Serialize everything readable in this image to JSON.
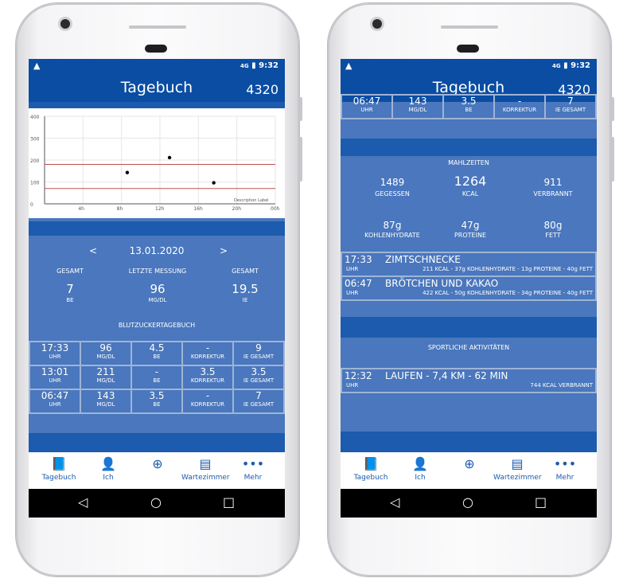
{
  "status": {
    "network": "4G",
    "time": "9:32"
  },
  "app": {
    "title": "Tagebuch",
    "points": "4320"
  },
  "chart_data": {
    "type": "scatter",
    "x_ticks": [
      "4h",
      "8h",
      "12h",
      "16h",
      "20h",
      "00h"
    ],
    "y_ticks": [
      "0",
      "100",
      "200",
      "300",
      "400"
    ],
    "ylim": [
      0,
      400
    ],
    "points": [
      {
        "x": 8.6,
        "y": 143
      },
      {
        "x": 13.0,
        "y": 211
      },
      {
        "x": 17.6,
        "y": 96
      }
    ],
    "limit_lines": [
      70,
      180
    ],
    "description_label": "Description Label",
    "line_color": "#c0504d"
  },
  "left": {
    "date": "13.01.2020",
    "prev_label": "<",
    "next_label": ">",
    "summary": [
      {
        "label": "GESAMT",
        "value": "7",
        "unit": "BE"
      },
      {
        "label": "LETZTE MESSUNG",
        "value": "96",
        "unit": "MG/DL"
      },
      {
        "label": "GESAMT",
        "value": "19.5",
        "unit": "IE"
      }
    ],
    "section_title": "BLUTZUCKERTAGEBUCH",
    "rows": [
      [
        {
          "v": "17:33",
          "u": "UHR"
        },
        {
          "v": "96",
          "u": "MG/DL"
        },
        {
          "v": "4.5",
          "u": "BE"
        },
        {
          "v": "-",
          "u": "KORREKTUR"
        },
        {
          "v": "9",
          "u": "IE GESAMT"
        }
      ],
      [
        {
          "v": "13:01",
          "u": "UHR"
        },
        {
          "v": "211",
          "u": "MG/DL"
        },
        {
          "v": "-",
          "u": "BE"
        },
        {
          "v": "3.5",
          "u": "KORREKTUR"
        },
        {
          "v": "3.5",
          "u": "IE GESAMT"
        }
      ],
      [
        {
          "v": "06:47",
          "u": "UHR"
        },
        {
          "v": "143",
          "u": "MG/DL"
        },
        {
          "v": "3.5",
          "u": "BE"
        },
        {
          "v": "-",
          "u": "KORREKTUR"
        },
        {
          "v": "7",
          "u": "IE GESAMT"
        }
      ]
    ]
  },
  "right": {
    "partial_row": [
      {
        "v": "06:47",
        "u": "UHR"
      },
      {
        "v": "143",
        "u": "MG/DL"
      },
      {
        "v": "3.5",
        "u": "BE"
      },
      {
        "v": "-",
        "u": "KORREKTUR"
      },
      {
        "v": "7",
        "u": "IE GESAMT"
      }
    ],
    "meals_title": "MAHLZEITEN",
    "meal_stats": [
      {
        "value": "1489",
        "label": "GEGESSEN"
      },
      {
        "value": "1264",
        "label": "KCAL"
      },
      {
        "value": "911",
        "label": "VERBRANNT"
      }
    ],
    "macro_stats": [
      {
        "value": "87g",
        "label": "KOHLENHYDRATE"
      },
      {
        "value": "47g",
        "label": "PROTEINE"
      },
      {
        "value": "80g",
        "label": "FETT"
      }
    ],
    "meals": [
      {
        "time": "17:33",
        "unit": "UHR",
        "name": "ZIMTSCHNECKE",
        "detail": "211 KCAL - 37g KOHLENHYDRATE - 13g PROTEINE - 40g FETT"
      },
      {
        "time": "06:47",
        "unit": "UHR",
        "name": "BRÖTCHEN UND KAKAO",
        "detail": "422 KCAL - 50g KOHLENHYDRATE - 34g PROTEINE - 40g FETT"
      }
    ],
    "sport_title": "SPORTLICHE AKTIVITÄTEN",
    "sports": [
      {
        "time": "12:32",
        "unit": "UHR",
        "name": "LAUFEN - 7,4 KM - 62 MIN",
        "detail": "744 KCAL VERBRANNT"
      }
    ]
  },
  "nav": [
    {
      "label": "Tagebuch",
      "icon": "book-icon",
      "glyph": "📘"
    },
    {
      "label": "Ich",
      "icon": "person-icon",
      "glyph": "👤"
    },
    {
      "label": "",
      "icon": "add-circle-icon",
      "glyph": "⊕"
    },
    {
      "label": "Wartezimmer",
      "icon": "chat-icon",
      "glyph": "▤"
    },
    {
      "label": "Mehr",
      "icon": "more-icon",
      "glyph": "•••"
    }
  ],
  "sysnav": {
    "back": "◁",
    "home": "○",
    "recent": "□"
  }
}
